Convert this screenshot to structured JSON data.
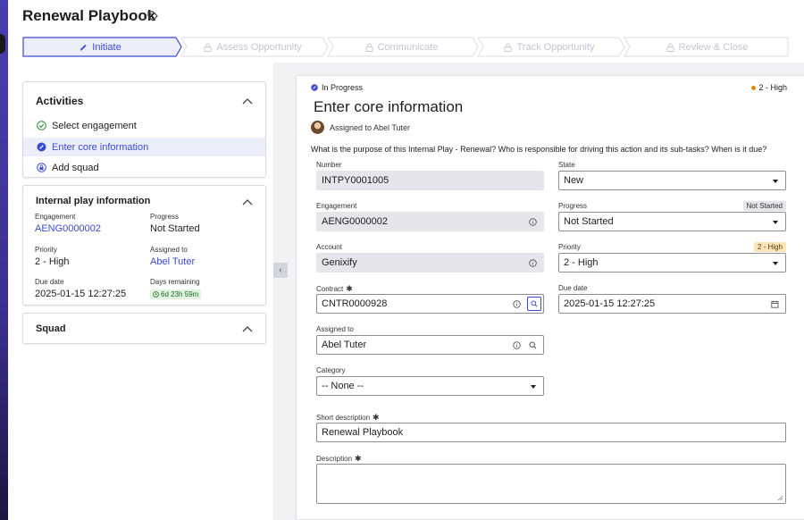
{
  "header": {
    "title": "Renewal Playbook",
    "tag_icon": "tag-icon"
  },
  "stepper": {
    "steps": [
      {
        "label": "Initiate",
        "state": "active",
        "icon": "pencil-icon"
      },
      {
        "label": "Assess Opportunity",
        "state": "locked",
        "icon": "lock-icon"
      },
      {
        "label": "Communicate",
        "state": "locked",
        "icon": "lock-icon"
      },
      {
        "label": "Track Opportunity",
        "state": "locked",
        "icon": "lock-icon"
      },
      {
        "label": "Review & Close",
        "state": "locked",
        "icon": "lock-icon"
      }
    ]
  },
  "activities": {
    "title": "Activities",
    "items": [
      {
        "label": "Select engagement",
        "status": "done"
      },
      {
        "label": "Enter core information",
        "status": "current"
      },
      {
        "label": "Add squad",
        "status": "pending"
      }
    ]
  },
  "info": {
    "title": "Internal play information",
    "engagement_label": "Engagement",
    "engagement_value": "AENG0000002",
    "progress_label": "Progress",
    "progress_value": "Not Started",
    "priority_label": "Priority",
    "priority_value": "2 - High",
    "assigned_label": "Assigned to",
    "assigned_value": "Abel Tuter",
    "due_label": "Due date",
    "due_value": "2025-01-15 12:27:25",
    "days_label": "Days remaining",
    "days_value": "6d 23h 59m"
  },
  "squad": {
    "title": "Squad"
  },
  "form": {
    "state_badge": "In Progress",
    "priority_badge": "2 - High",
    "title": "Enter core information",
    "assigned_line": "Assigned to Abel Tuter",
    "question": "What is the purpose of this Internal Play - Renewal? Who is responsible for driving this action and its sub-tasks? When is it due?",
    "number_label": "Number",
    "number_value": "INTPY0001005",
    "state_label": "State",
    "state_value": "New",
    "engagement_label": "Engagement",
    "engagement_value": "AENG0000002",
    "progress_label": "Progress",
    "progress_badge": "Not Started",
    "progress_value": "Not Started",
    "account_label": "Account",
    "account_value": "Genixify",
    "priority_label": "Priority",
    "priority_value": "2 - High",
    "contract_label": "Contract",
    "contract_value": "CNTR0000928",
    "due_label": "Due date",
    "due_value": "2025-01-15 12:27:25",
    "assigned_label": "Assigned to",
    "assigned_value": "Abel Tuter",
    "category_label": "Category",
    "category_value": "-- None --",
    "short_desc_label": "Short description",
    "short_desc_value": "Renewal Playbook",
    "description_label": "Description",
    "description_value": "",
    "required_mark": "✱"
  },
  "colors": {
    "accent": "#3b4ad6",
    "sidebar": "#4a3fb0",
    "priority_dot": "#e8870e",
    "high_badge": "#fde3b8",
    "success": "#2e8b3a"
  }
}
